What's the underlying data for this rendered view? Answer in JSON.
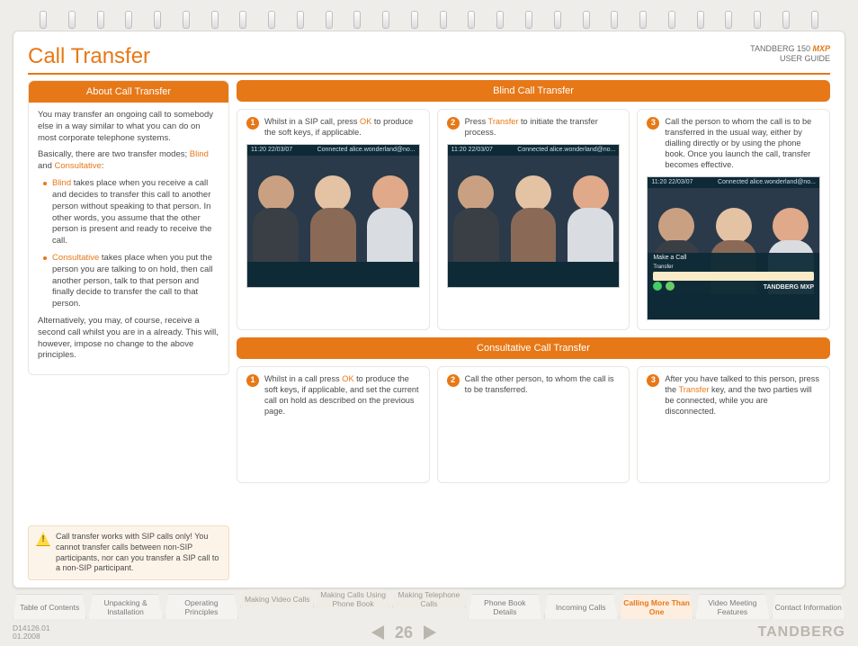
{
  "header": {
    "title": "Call Transfer",
    "brand_line1": "TANDBERG 150",
    "brand_mxp": "MXP",
    "brand_line2": "USER GUIDE"
  },
  "about": {
    "heading": "About Call Transfer",
    "p1": "You may transfer an ongoing call to somebody else in a way similar to what you can do on most corporate telephone systems.",
    "p2_a": "Basically, there are two transfer modes; ",
    "p2_blind": "Blind",
    "p2_b": " and ",
    "p2_cons": "Consultative",
    "p2_c": ":",
    "bullet1_lead": "Blind",
    "bullet1_rest": " takes place when you receive a call and decides to transfer this call to another person without speaking to that person. In other words, you assume that the other person is present and ready to receive the call.",
    "bullet2_lead": "Consultative",
    "bullet2_rest": " takes place when you put the person you are talking to on hold, then call another person, talk to that person and finally decide to transfer the call to that person.",
    "p3": "Alternatively, you may, of course, receive a second call whilst you are in a already. This will, however, impose no change to the above principles.",
    "warning": "Call transfer works with SIP calls only! You cannot transfer calls between non-SIP participants, nor can you transfer a SIP call to a non-SIP participant."
  },
  "blind": {
    "heading": "Blind Call Transfer",
    "step1_a": "Whilst in a SIP call, press ",
    "step1_ok": "OK",
    "step1_b": " to produce the soft keys, if applicable.",
    "step2_a": "Press ",
    "step2_tr": "Transfer",
    "step2_b": " to initiate the transfer process.",
    "step3": "Call the person to whom the call is to be transferred in the usual way, either by dialling directly or by using the phone book. Once you launch the call, transfer becomes effective.",
    "screen_top_time": "11:20  22/03/07",
    "screen_top_status": "Connected alice.wonderland@no...",
    "menu_title": "Make a Call",
    "menu_field_label": "Transfer",
    "menu_brand": "TANDBERG MXP"
  },
  "cons": {
    "heading": "Consultative Call Transfer",
    "step1_a": "Whilst in a call press ",
    "step1_ok": "OK",
    "step1_b": " to produce the soft keys, if applicable, and set the current call on hold as described on the previous page.",
    "step2": "Call the other person, to whom the call is to be transferred.",
    "step3_a": "After you have talked to this person, press the ",
    "step3_tr": "Transfer",
    "step3_b": " key, and the two parties will be connected, while you are disconnected."
  },
  "nums": {
    "n1": "1",
    "n2": "2",
    "n3": "3"
  },
  "tabs": {
    "t1": "Table of Contents",
    "t2": "Unpacking & Installation",
    "t3": "Operating Principles",
    "t4": "Making Video Calls",
    "t5": "Making Calls Using Phone Book",
    "t6": "Making Telephone Calls",
    "t7": "Phone Book Details",
    "t8": "Incoming Calls",
    "t9": "Calling More Than One",
    "t10": "Video Meeting Features",
    "t11": "Contact Information"
  },
  "footer": {
    "doc1": "D14126.01",
    "doc2": "01.2008",
    "page": "26",
    "logo": "TANDBERG"
  }
}
